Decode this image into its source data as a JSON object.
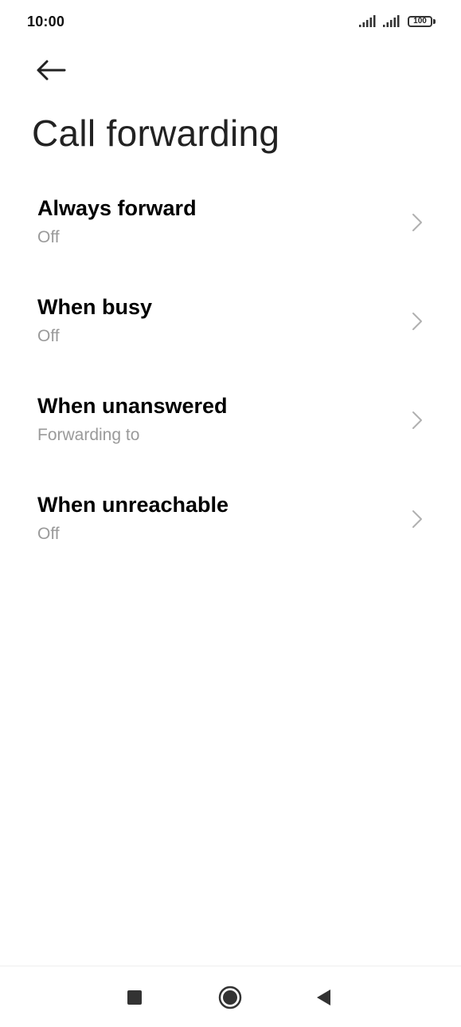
{
  "status_bar": {
    "time": "10:00",
    "battery": "100",
    "icons": [
      "signal-icon",
      "signal-icon",
      "battery-icon"
    ]
  },
  "header": {
    "back_icon": "arrow-left-icon",
    "title": "Call forwarding"
  },
  "settings": [
    {
      "label": "Always forward",
      "status": "Off"
    },
    {
      "label": "When busy",
      "status": "Off"
    },
    {
      "label": "When unanswered",
      "status": "Forwarding to"
    },
    {
      "label": "When unreachable",
      "status": "Off"
    }
  ],
  "nav_bar": {
    "icons": [
      "recents-square-icon",
      "home-circle-icon",
      "back-triangle-icon"
    ]
  },
  "colors": {
    "background": "#ffffff",
    "title": "#222222",
    "label": "#000000",
    "status": "#9a9a9a",
    "chevron": "#b0b0b0"
  }
}
